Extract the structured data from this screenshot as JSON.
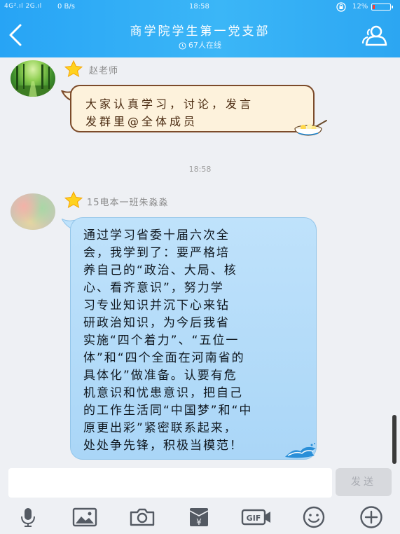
{
  "status_bar": {
    "signal": "4G².ıl 2G.ıl",
    "speed": "0 B/s",
    "time": "18:58",
    "battery_text": "12%",
    "battery_level": 0.12,
    "battery_color": "#ff3b30"
  },
  "header": {
    "title": "商学院学生第一党支部",
    "online": "67人在线",
    "back_icon": "back-chevron-icon",
    "group_icon": "group-members-icon",
    "background": "#2ea8f4"
  },
  "messages": [
    {
      "sender": "赵老师",
      "lines": [
        "大家认真学习，讨论，发言",
        "发群里@全体成员"
      ],
      "bubble_color": "#fdf2dc"
    },
    {
      "sender": "15电本一班朱淼淼",
      "lines": [
        "通过学习省委十届六次全",
        "会，我学到了：要严格培",
        "养自己的“政治、大局、核",
        "心、看齐意识”，努力学",
        "习专业知识并沉下心来钻",
        "研政治知识，为今后我省",
        "实施“四个着力”、“五位一",
        "体”和“四个全面在河南省的",
        "具体化”做准备。认要有危",
        "机意识和忧患意识，把自己",
        "的工作生活同“中国梦”和“中",
        "原更出彩”紧密联系起来，",
        "处处争先锋，积极当模范！"
      ],
      "bubble_color": "#b5dcf9"
    }
  ],
  "timestamp": "18:58",
  "input": {
    "value": "",
    "placeholder": "",
    "send_label": "发送"
  },
  "toolbar": {
    "icons": [
      "microphone-icon",
      "image-icon",
      "camera-icon",
      "red-packet-icon",
      "gif-icon",
      "emoji-icon",
      "plus-icon"
    ],
    "gif_label": "GIF",
    "red_packet_label": "¥"
  }
}
